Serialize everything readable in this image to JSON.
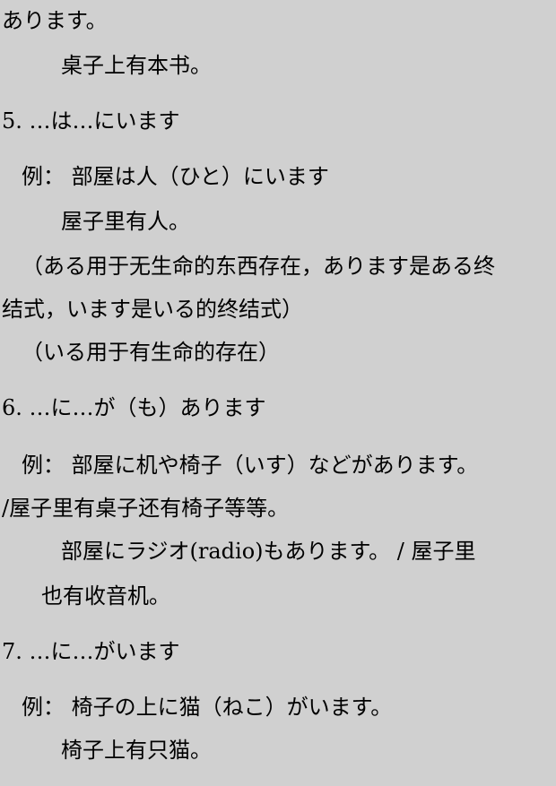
{
  "document": {
    "lines": [
      "あります。",
      "桌子上有本书。",
      "5. …は…にいます",
      "例： 部屋は人（ひと）にいます",
      "屋子里有人。",
      "（ある用于无生命的东西存在，あります是ある终",
      "结式，います是いる的终结式）",
      "（いる用于有生命的存在）",
      "6. …に…が（も）あります",
      "例： 部屋に机や椅子（いす）などがあります。",
      "/屋子里有桌子还有椅子等等。",
      "部屋にラジオ(radio)もあります。 / 屋子里",
      "也有收音机。",
      "7. …に…がいます",
      "例： 椅子の上に猫（ねこ）がいます。",
      "椅子上有只猫。"
    ]
  }
}
